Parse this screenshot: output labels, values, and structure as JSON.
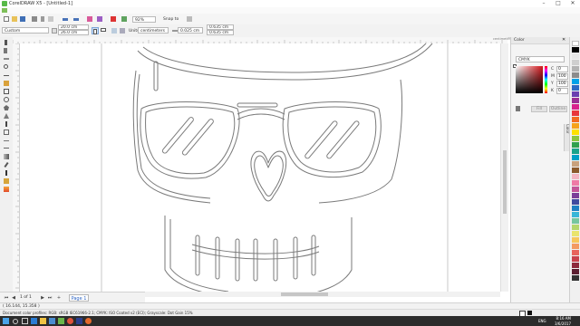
{
  "window": {
    "title": "CorelDRAW X5 - [Untitled-1]",
    "controls": [
      "–",
      "□",
      "✕"
    ]
  },
  "standard_toolbar": {
    "zoom": "92%",
    "snap_to": "Snap to"
  },
  "property_bar": {
    "preset": "Custom",
    "width": "20.0 cm",
    "height": "26.0 cm",
    "units_label": "Units:",
    "units_value": "centimeters",
    "nudge": "0.025 cm",
    "dup_x": "0.635 cm",
    "dup_y": "0.635 cm"
  },
  "ruler": {
    "h_unit": "centimeters"
  },
  "page_nav": {
    "counter": "1 of 1",
    "page_tab": "Page 1"
  },
  "status_bar": {
    "coordinates": "( 16.144, 15.358 )",
    "color_profiles": "Document color profiles: RGB: sRGB IEC61966-2.1; CMYK: ISO Coated v2 (ECI); Grayscale: Dot Gain 15%"
  },
  "docker": {
    "title": "Color",
    "model": "CMYK",
    "channels": [
      {
        "label": "C",
        "value": "0"
      },
      {
        "label": "M",
        "value": "100"
      },
      {
        "label": "Y",
        "value": "100"
      },
      {
        "label": "K",
        "value": "0"
      }
    ],
    "fill_button": "Fill",
    "outline_button": "Outline",
    "tab_label": "Color"
  },
  "palette": {
    "colors": [
      "#ffffff",
      "#000000",
      "#e6e6e6",
      "#cfcfcf",
      "#b3b3b3",
      "#8c8c8c",
      "#00a2e8",
      "#2d6ac4",
      "#6a3fb0",
      "#9b2f94",
      "#d8228d",
      "#e8363b",
      "#f26b21",
      "#f6a31b",
      "#fde100",
      "#8cc63f",
      "#30a14e",
      "#1aa38a",
      "#00a0c6",
      "#c8a27c",
      "#8b5a2b",
      "#f4b6c2",
      "#ef7aa6",
      "#c45599",
      "#7b3f98",
      "#3f4a9f",
      "#1e7fc3",
      "#38b6d8",
      "#76c69f",
      "#b5d66d",
      "#e9e46c",
      "#f7c65b",
      "#f39a63",
      "#e8645d",
      "#c8424d",
      "#8d2b3d",
      "#5a1e30",
      "#323232"
    ]
  },
  "taskbar": {
    "time": "8:16 AM",
    "date": "3/6/2017",
    "lang": "ENG",
    "apps": [
      "windows",
      "search",
      "task-view",
      "edge",
      "explorer",
      "store",
      "coreldraw",
      "chrome",
      "photoshop",
      "media"
    ]
  },
  "canvas": {
    "outline_color": "#777777"
  }
}
